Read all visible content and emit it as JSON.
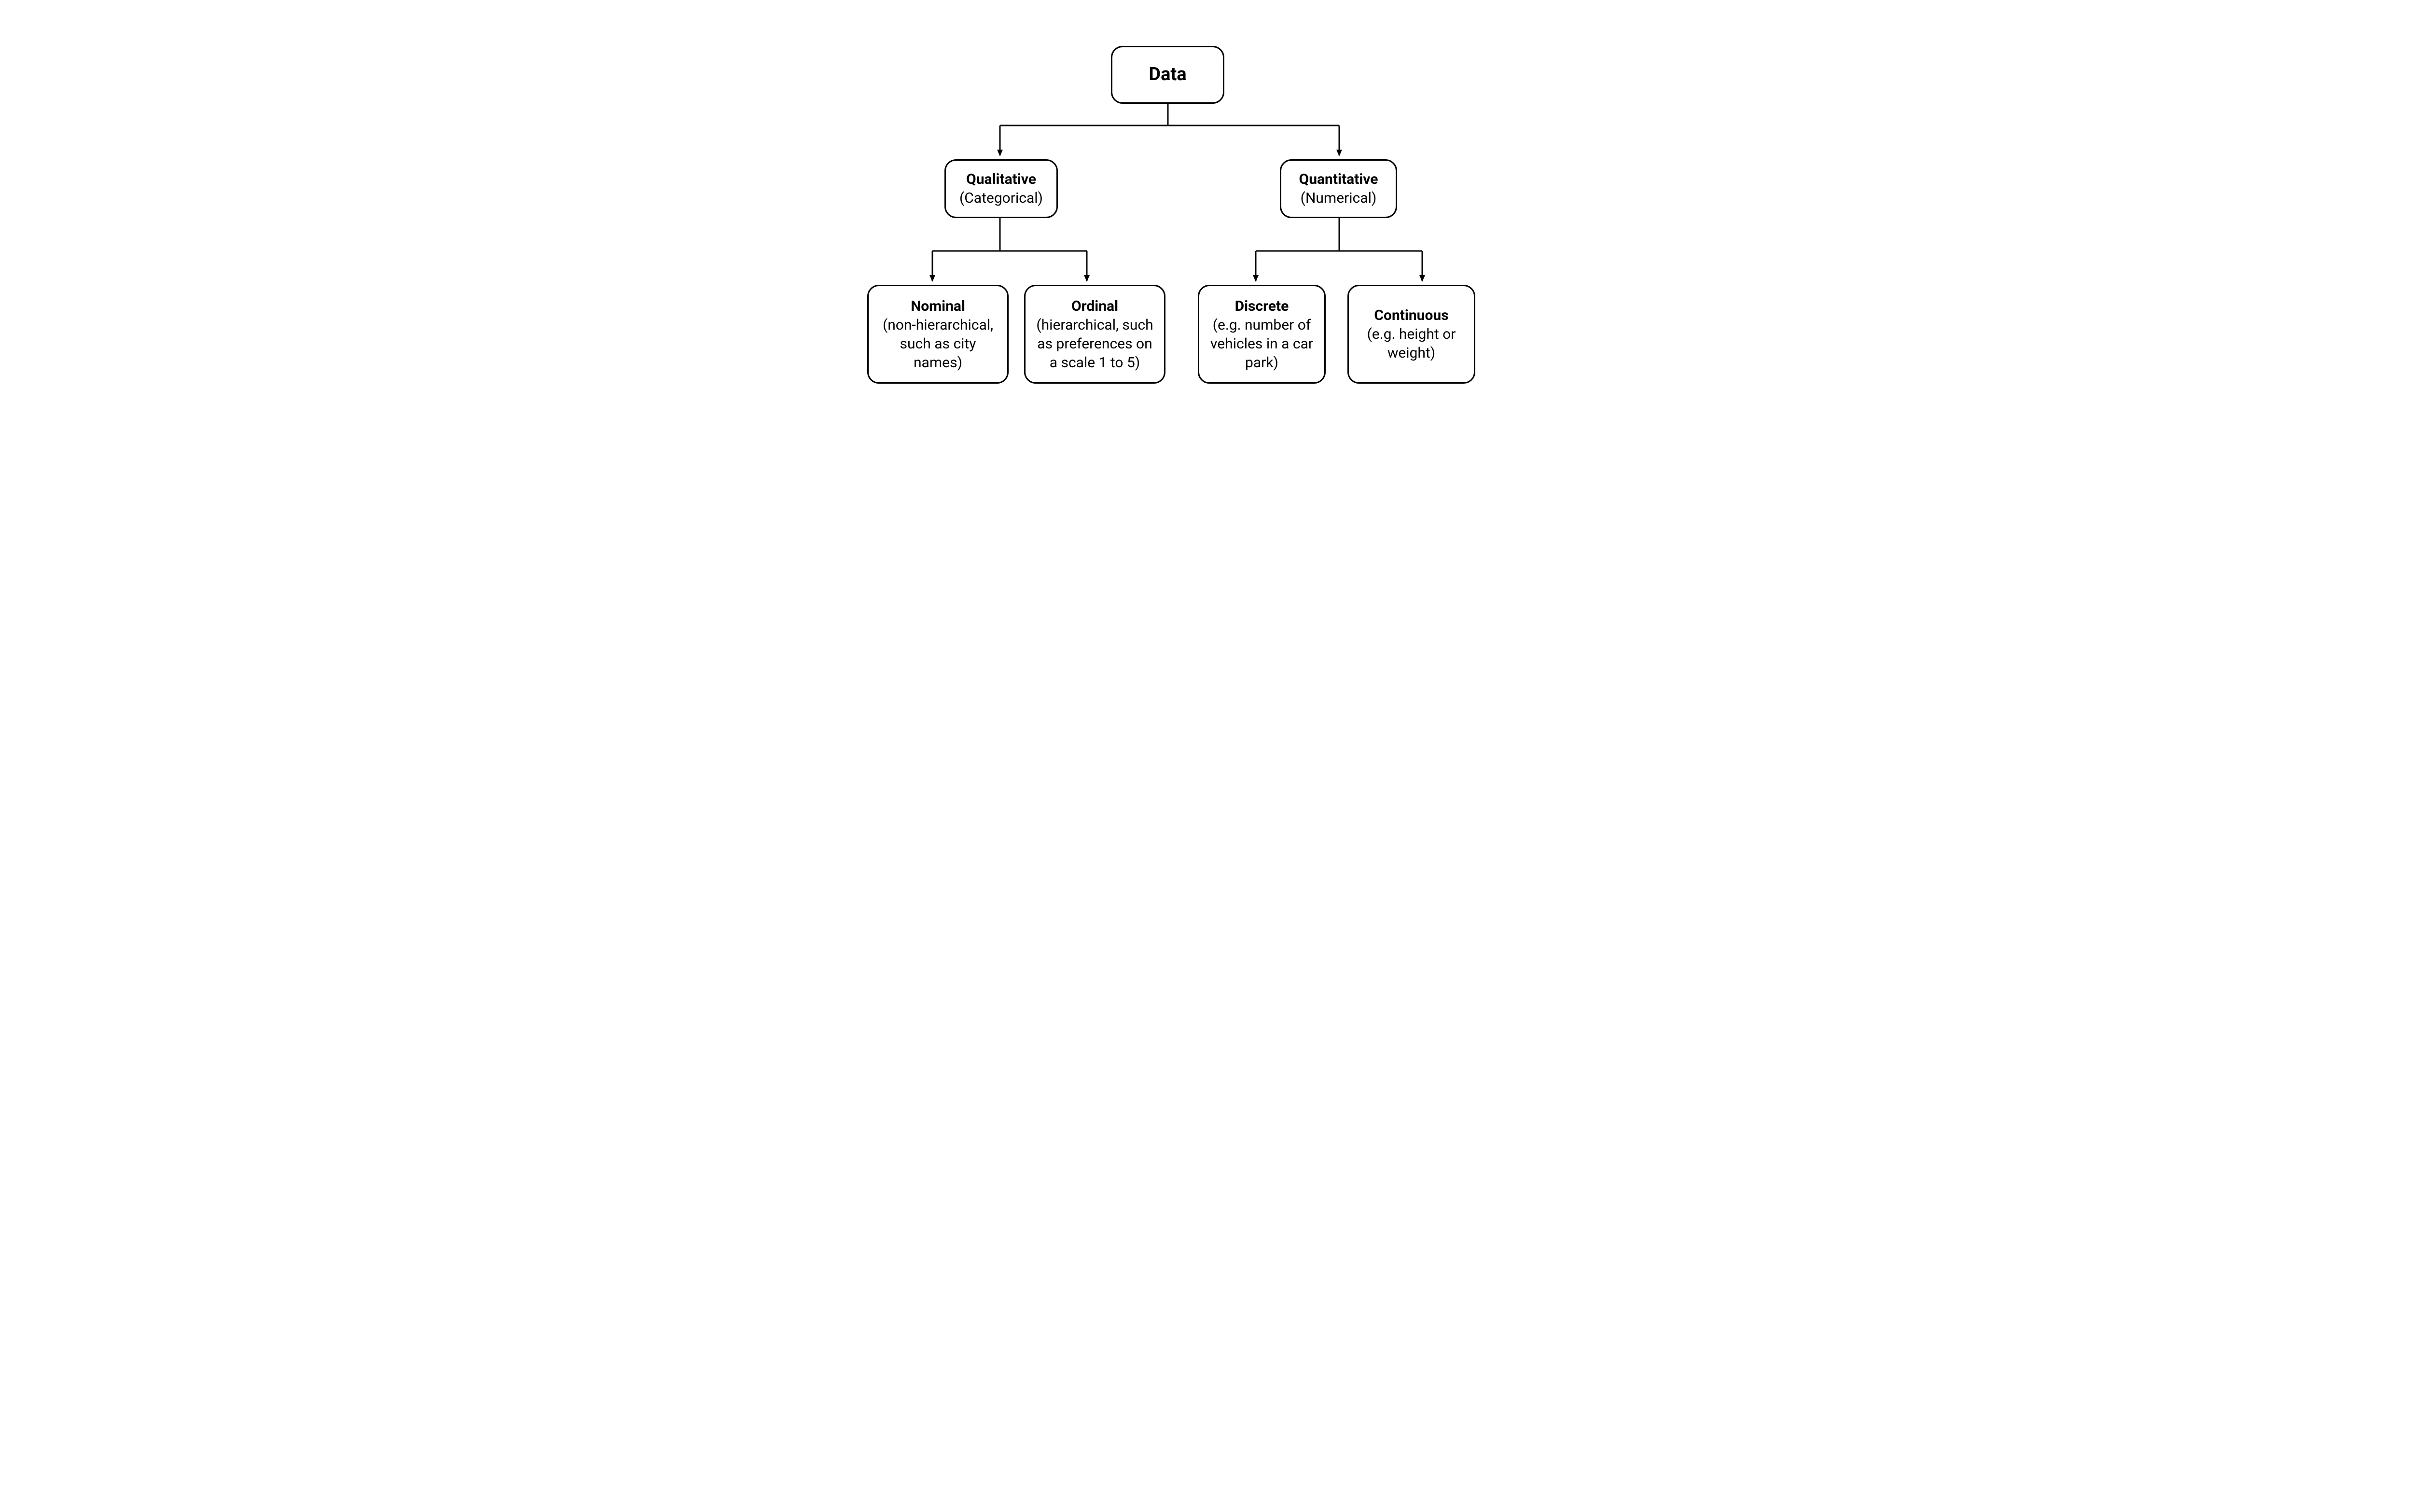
{
  "diagram": {
    "root": {
      "title": "Data"
    },
    "qualitative": {
      "title": "Qualitative",
      "subtitle": "(Categorical)"
    },
    "quantitative": {
      "title": "Quantitative",
      "subtitle": "(Numerical)"
    },
    "nominal": {
      "title": "Nominal",
      "subtitle": "(non-hierarchical, such as city names)"
    },
    "ordinal": {
      "title": "Ordinal",
      "subtitle": "(hierarchical, such as preferences on a scale 1 to 5)"
    },
    "discrete": {
      "title": "Discrete",
      "subtitle": "(e.g. number of vehicles in a car park)"
    },
    "continuous": {
      "title": "Continuous",
      "subtitle": "(e.g. height or weight)"
    }
  }
}
